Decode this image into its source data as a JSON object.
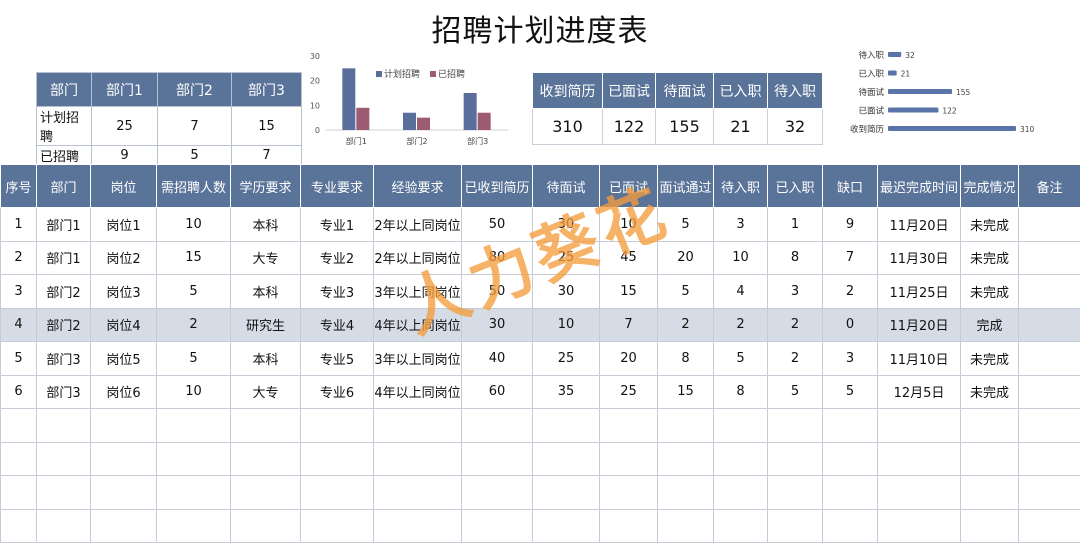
{
  "title": "招聘计划进度表",
  "summary": {
    "headers": [
      "部门",
      "部门1",
      "部门2",
      "部门3"
    ],
    "rows": [
      {
        "label": "计划招聘",
        "values": [
          "25",
          "7",
          "15"
        ]
      },
      {
        "label": "已招聘",
        "values": [
          "9",
          "5",
          "7"
        ]
      }
    ]
  },
  "stats": {
    "headers": [
      "收到简历",
      "已面试",
      "待面试",
      "已入职",
      "待入职"
    ],
    "values": [
      "310",
      "122",
      "155",
      "21",
      "32"
    ]
  },
  "chart_data": [
    {
      "type": "bar",
      "categories": [
        "部门1",
        "部门2",
        "部门3"
      ],
      "series": [
        {
          "name": "计划招聘",
          "values": [
            25,
            7,
            15
          ]
        },
        {
          "name": "已招聘",
          "values": [
            9,
            5,
            7
          ]
        }
      ],
      "yticks": [
        "0",
        "10",
        "20",
        "30"
      ],
      "ylim": [
        0,
        30
      ],
      "legend": "top-right",
      "colors": [
        "#5a6e9c",
        "#9c5b73"
      ]
    },
    {
      "type": "bar",
      "orientation": "horizontal",
      "categories": [
        "待入职",
        "已入职",
        "待面试",
        "已面试",
        "收到简历"
      ],
      "values": [
        32,
        21,
        155,
        122,
        310
      ],
      "labels": [
        "32",
        "21",
        "155",
        "122",
        "310"
      ],
      "colors": [
        "#5a73a8"
      ]
    }
  ],
  "table": {
    "headers": [
      "序号",
      "部门",
      "岗位",
      "需招聘人数",
      "学历要求",
      "专业要求",
      "经验要求",
      "已收到简历",
      "待面试",
      "已面试",
      "面试通过",
      "待入职",
      "已入职",
      "缺口",
      "最迟完成时间",
      "完成情况",
      "备注"
    ],
    "rows": [
      [
        "1",
        "部门1",
        "岗位1",
        "10",
        "本科",
        "专业1",
        "2年以上同岗位",
        "50",
        "30",
        "10",
        "5",
        "3",
        "1",
        "9",
        "11月20日",
        "未完成",
        ""
      ],
      [
        "2",
        "部门1",
        "岗位2",
        "15",
        "大专",
        "专业2",
        "2年以上同岗位",
        "80",
        "25",
        "45",
        "20",
        "10",
        "8",
        "7",
        "11月30日",
        "未完成",
        ""
      ],
      [
        "3",
        "部门2",
        "岗位3",
        "5",
        "本科",
        "专业3",
        "3年以上同岗位",
        "50",
        "30",
        "15",
        "5",
        "4",
        "3",
        "2",
        "11月25日",
        "未完成",
        ""
      ],
      [
        "4",
        "部门2",
        "岗位4",
        "2",
        "研究生",
        "专业4",
        "4年以上同岗位",
        "30",
        "10",
        "7",
        "2",
        "2",
        "2",
        "0",
        "11月20日",
        "完成",
        ""
      ],
      [
        "5",
        "部门3",
        "岗位5",
        "5",
        "本科",
        "专业5",
        "3年以上同岗位",
        "40",
        "25",
        "20",
        "8",
        "5",
        "2",
        "3",
        "11月10日",
        "未完成",
        ""
      ],
      [
        "6",
        "部门3",
        "岗位6",
        "10",
        "大专",
        "专业6",
        "4年以上同岗位",
        "60",
        "35",
        "25",
        "15",
        "8",
        "5",
        "5",
        "12月5日",
        "未完成",
        ""
      ]
    ],
    "empty_rows": 4,
    "highlight_row": 3
  },
  "watermark": "人力葵花"
}
